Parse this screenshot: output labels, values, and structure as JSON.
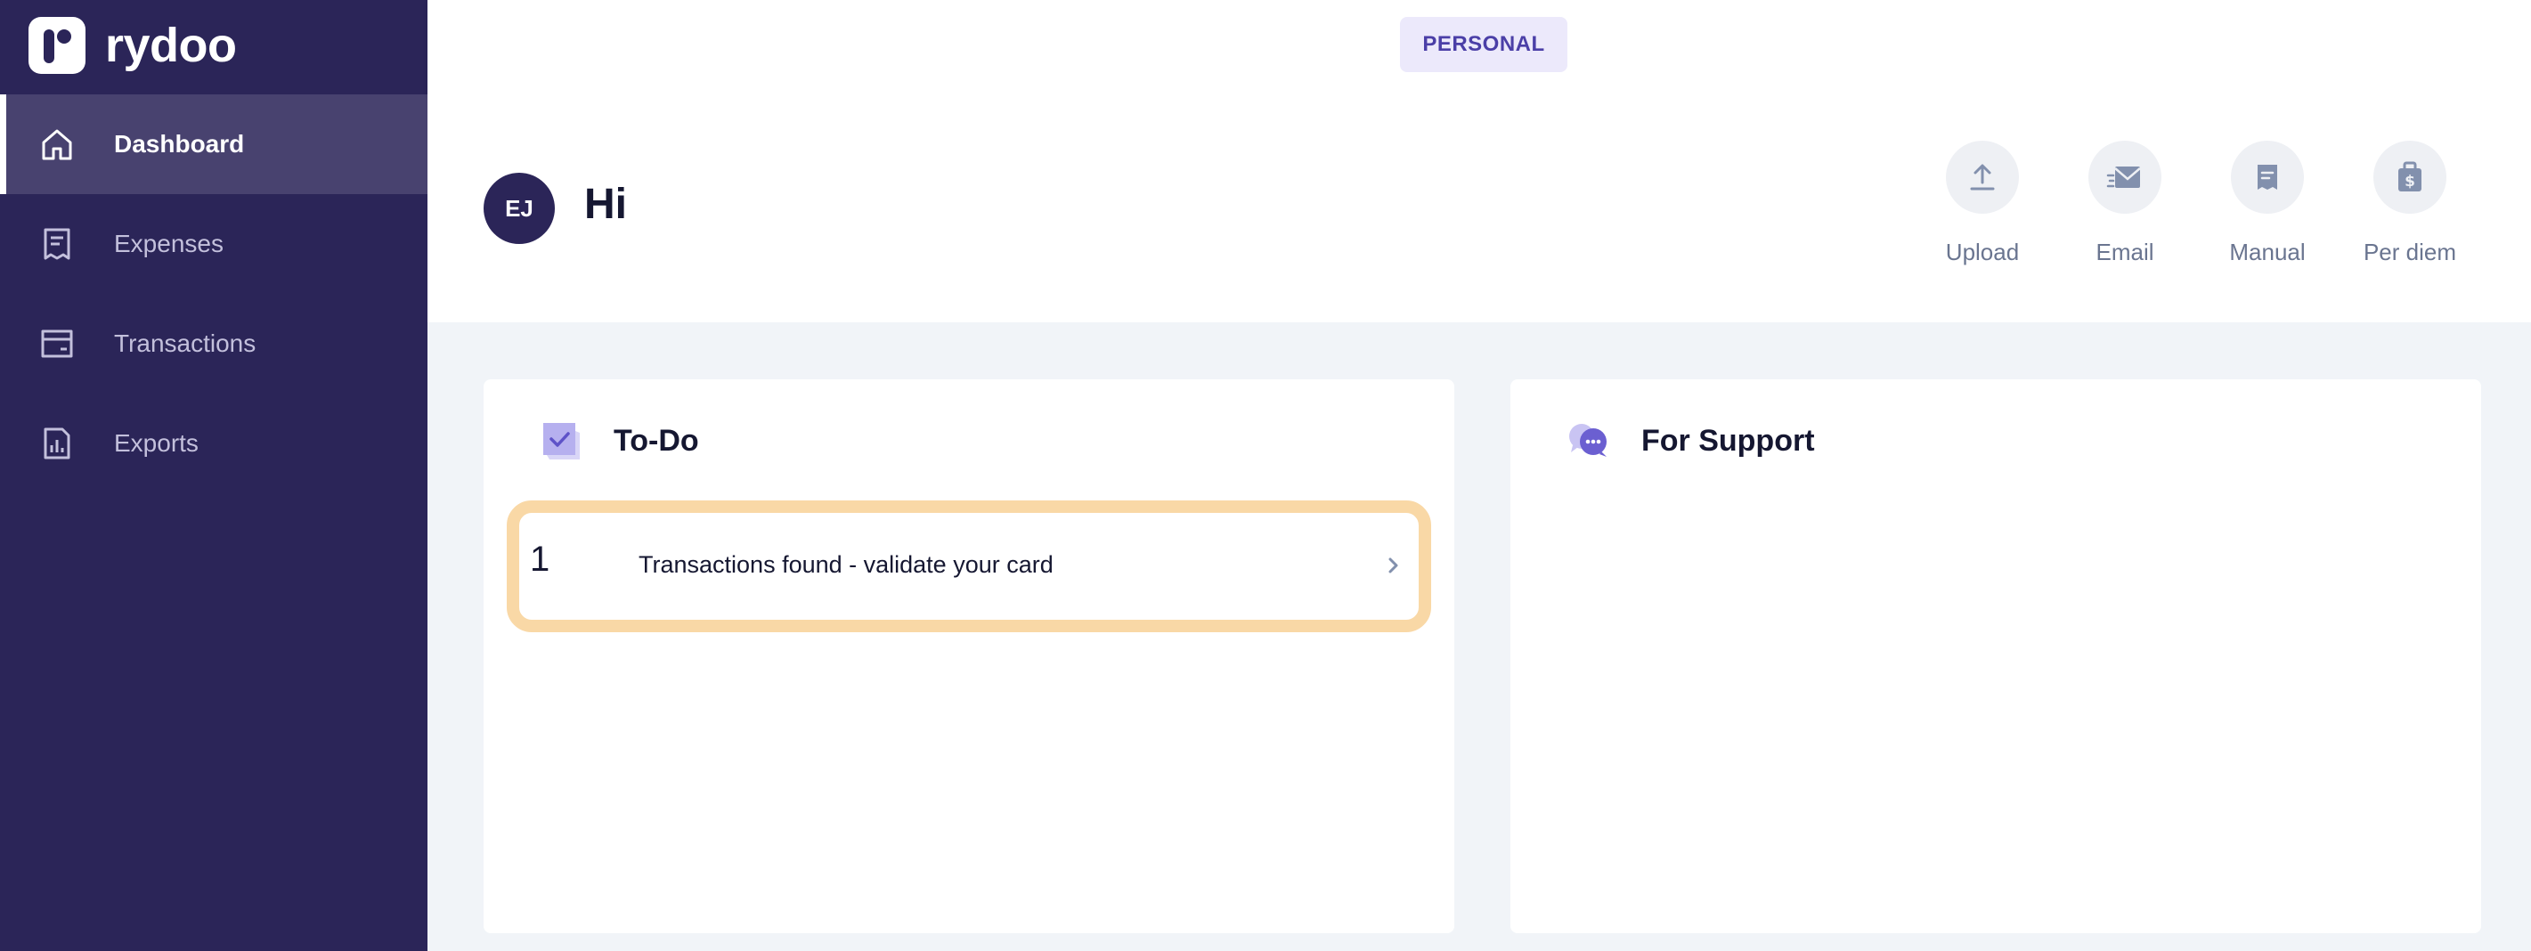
{
  "app": {
    "logo_text": "rydoo"
  },
  "sidebar": {
    "items": [
      {
        "label": "Dashboard",
        "icon": "home-icon",
        "active": true
      },
      {
        "label": "Expenses",
        "icon": "receipt-icon",
        "active": false
      },
      {
        "label": "Transactions",
        "icon": "card-icon",
        "active": false
      },
      {
        "label": "Exports",
        "icon": "chart-file-icon",
        "active": false
      }
    ]
  },
  "topbar": {
    "mode_label": "PERSONAL"
  },
  "header": {
    "avatar_initials": "EJ",
    "greeting": "Hi",
    "actions": [
      {
        "label": "Upload",
        "icon": "upload-icon"
      },
      {
        "label": "Email",
        "icon": "email-icon"
      },
      {
        "label": "Manual",
        "icon": "manual-receipt-icon"
      },
      {
        "label": "Per diem",
        "icon": "per-diem-icon"
      }
    ]
  },
  "todo": {
    "title": "To-Do",
    "items": [
      {
        "count": "1",
        "text": "Transactions found - validate your card"
      }
    ]
  },
  "support": {
    "title": "For Support"
  },
  "colors": {
    "sidebar_bg": "#2b2558",
    "active_nav_bg": "#48426f",
    "accent": "#4b3fa7",
    "highlight_border": "#f9d8a6",
    "page_bg": "#f1f4f8"
  }
}
